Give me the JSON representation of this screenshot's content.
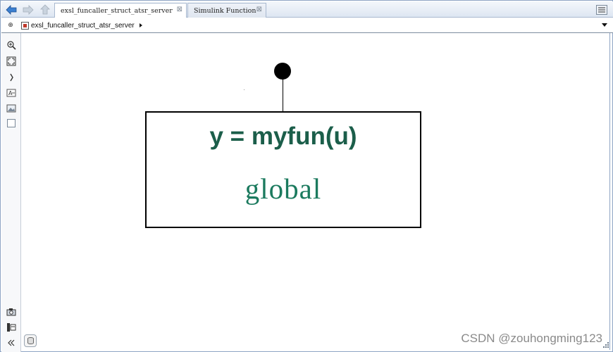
{
  "tabs": [
    {
      "label": "exsl_funcaller_struct_atsr_server",
      "close": "⊠",
      "active": true
    },
    {
      "label": "Simulink Function",
      "close": "⊠",
      "active": false
    }
  ],
  "breadcrumb": {
    "model": "exsl_funcaller_struct_atsr_server",
    "left_button": "⊕"
  },
  "block": {
    "title": "y = myfun(u)",
    "subtitle": "global"
  },
  "watermark": "CSDN @zouhongming123",
  "colors": {
    "block_title": "#1b5e4a",
    "block_subtitle": "#1b7a5e",
    "frame_border": "#8ea4c4"
  },
  "icons": {
    "back": "back-arrow-icon",
    "forward": "forward-arrow-icon",
    "up": "up-arrow-icon",
    "tab_list": "tab-list-icon",
    "zoom": "zoom-icon",
    "fit_view": "fit-view-icon",
    "annotation": "annotation-icon",
    "image": "image-icon",
    "area": "area-icon",
    "camera": "camera-icon",
    "model_browser": "model-browser-icon",
    "collapse": "collapse-icon"
  }
}
